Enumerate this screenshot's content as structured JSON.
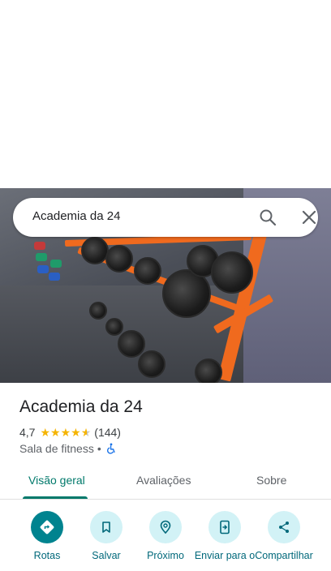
{
  "search": {
    "query": "Academia da 24"
  },
  "place": {
    "name": "Academia da 24",
    "rating": "4,7",
    "stars_value": 4.7,
    "review_count": "(144)",
    "category": "Sala de fitness",
    "separator": "•"
  },
  "tabs": [
    {
      "label": "Visão geral",
      "active": true
    },
    {
      "label": "Avaliações",
      "active": false
    },
    {
      "label": "Sobre",
      "active": false
    }
  ],
  "actions": [
    {
      "label": "Rotas",
      "icon": "directions-icon"
    },
    {
      "label": "Salvar",
      "icon": "bookmark-icon"
    },
    {
      "label": "Próximo",
      "icon": "nearby-icon"
    },
    {
      "label": "Enviar para o",
      "icon": "send-to-phone-icon"
    },
    {
      "label": "Compartilhar",
      "icon": "share-icon"
    }
  ],
  "colors": {
    "accent": "#00796b",
    "action_bg": "#d2f2f6",
    "primary_action": "#00838f",
    "star": "#f5b400"
  }
}
